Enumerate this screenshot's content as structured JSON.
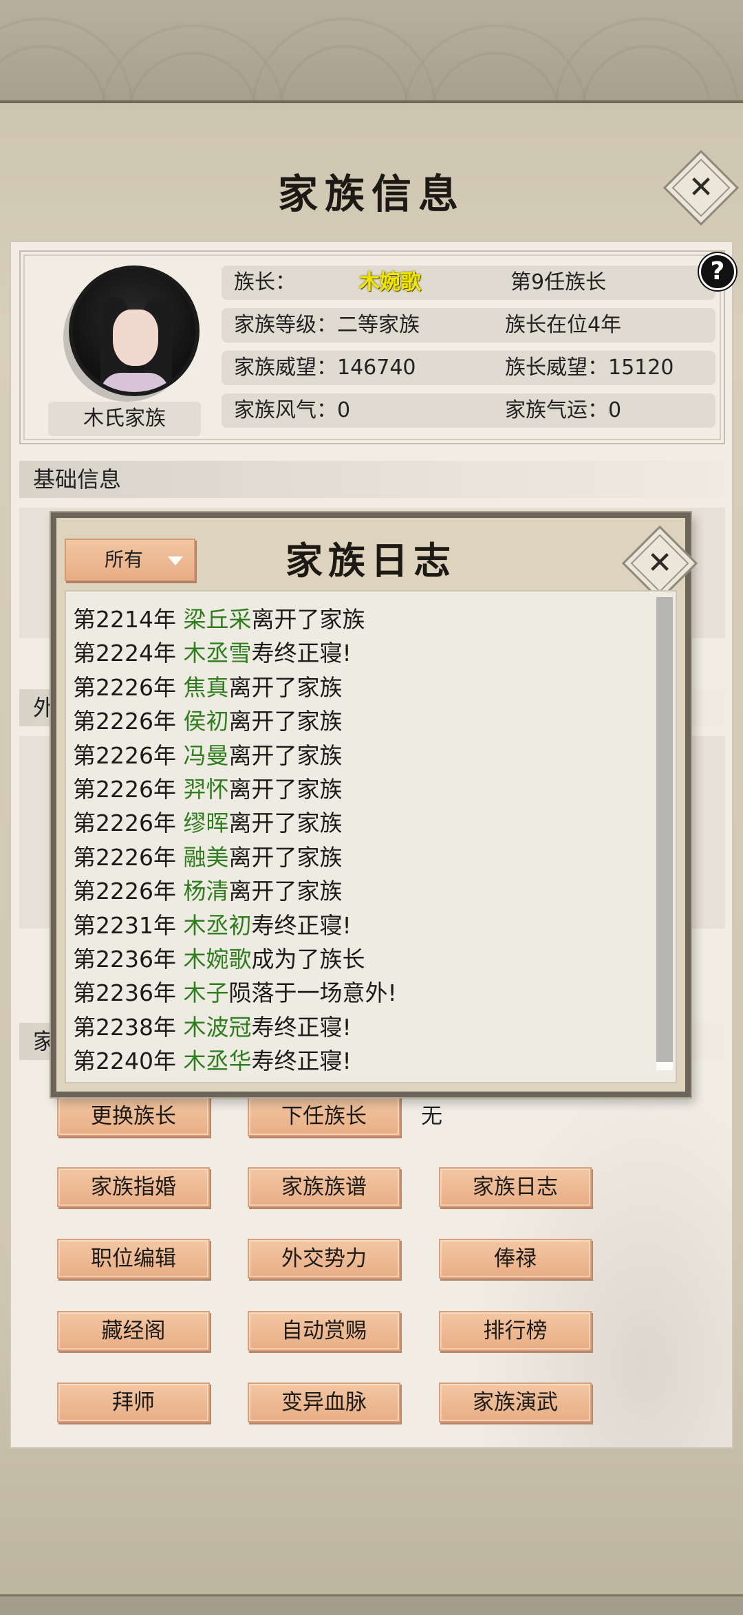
{
  "title": "家族信息",
  "close_icon": "✕",
  "info": {
    "family_name": "木氏家族",
    "leader_label": "族长：",
    "leader_name": "木婉歌",
    "leader_generation": "第9任族长",
    "level": "家族等级：二等家族",
    "tenure": "族长在位4年",
    "prestige": "家族威望：146740",
    "leader_prestige": "族长威望：15120",
    "style": "家族风气：0",
    "fortune": "家族气运：0",
    "help": "?"
  },
  "sections": {
    "basic": "基础信息",
    "foreign_partial": "外",
    "family_partial": "家"
  },
  "buttons": {
    "change_leader": "更换族长",
    "next_leader": "下任族长",
    "next_leader_value": "无",
    "marriage": "家族指婚",
    "genealogy": "家族族谱",
    "log": "家族日志",
    "positions": "职位编辑",
    "diplomacy": "外交势力",
    "salary": "俸禄",
    "library": "藏经阁",
    "auto_reward": "自动赏赐",
    "ranking": "排行榜",
    "apprentice": "拜师",
    "bloodline": "变异血脉",
    "martial": "家族演武"
  },
  "dialog": {
    "title": "家族日志",
    "filter": "所有",
    "entries": [
      {
        "year": "第2214年",
        "name": "梁丘采",
        "event": "离开了家族"
      },
      {
        "year": "第2224年",
        "name": "木丞雪",
        "event": "寿终正寝!"
      },
      {
        "year": "第2226年",
        "name": "焦真",
        "event": "离开了家族"
      },
      {
        "year": "第2226年",
        "name": "侯初",
        "event": "离开了家族"
      },
      {
        "year": "第2226年",
        "name": "冯曼",
        "event": "离开了家族"
      },
      {
        "year": "第2226年",
        "name": "羿怀",
        "event": "离开了家族"
      },
      {
        "year": "第2226年",
        "name": "缪晖",
        "event": "离开了家族"
      },
      {
        "year": "第2226年",
        "name": "融美",
        "event": "离开了家族"
      },
      {
        "year": "第2226年",
        "name": "杨清",
        "event": "离开了家族"
      },
      {
        "year": "第2231年",
        "name": "木丞初",
        "event": "寿终正寝!"
      },
      {
        "year": "第2236年",
        "name": "木婉歌",
        "event": "成为了族长"
      },
      {
        "year": "第2236年",
        "name": "木子",
        "event": "陨落于一场意外!"
      },
      {
        "year": "第2238年",
        "name": "木波冠",
        "event": "寿终正寝!"
      },
      {
        "year": "第2240年",
        "name": "木丞华",
        "event": "寿终正寝!"
      }
    ]
  }
}
